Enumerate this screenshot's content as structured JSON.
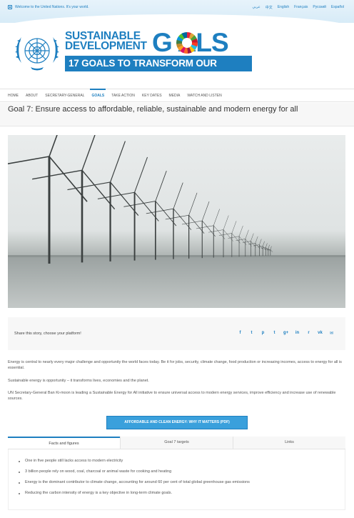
{
  "topbar": {
    "welcome": "Welcome to the United Nations. It's your world.",
    "languages": [
      "عربي",
      "中文",
      "English",
      "Français",
      "Русский",
      "Español"
    ]
  },
  "header": {
    "title_line1": "SUSTAINABLE",
    "title_line2": "DEVELOPMENT",
    "goals_word": "G  ALS",
    "tagline": "17 GOALS TO TRANSFORM OUR WORLD"
  },
  "nav": {
    "items": [
      "HOME",
      "ABOUT",
      "SECRETARY-GENERAL",
      "GOALS",
      "TAKE ACTION",
      "KEY DATES",
      "MEDIA",
      "WATCH AND LISTEN"
    ],
    "active": "GOALS"
  },
  "page": {
    "title": "Goal 7: Ensure access to affordable, reliable, sustainable and modern energy for all"
  },
  "share": {
    "label": "Share this story, choose your platform!",
    "icons": [
      "facebook-icon",
      "twitter-icon",
      "pinterest-icon",
      "tumblr-icon",
      "googleplus-icon",
      "linkedin-icon",
      "reddit-icon",
      "vk-icon",
      "email-icon"
    ],
    "glyphs": [
      "f",
      "t",
      "p",
      "t",
      "g+",
      "in",
      "r",
      "vk",
      "✉"
    ]
  },
  "content": {
    "p1": "Energy is central to nearly every major challenge and opportunity the world faces today. Be it for jobs, security, climate change, food production or increasing incomes, access to energy for all is essential.",
    "p2": "Sustainable energy is opportunity – it transforms lives, economies and the planet.",
    "p3": "UN Secretary-General Ban Ki-moon is leading a Sustainable Energy for All initiative to ensure universal access to modern energy services, improve efficiency and increase use of renewable sources.",
    "pdf_button": "AFFORDABLE AND CLEAN ENERGY: WHY IT MATTERS (PDF)"
  },
  "tabs": {
    "labels": [
      "Facts and figures",
      "Goal 7 targets",
      "Links"
    ],
    "active": "Facts and figures"
  },
  "facts": [
    "One in five people still lacks access to modern electricity",
    "3 billion people rely on wood, coal, charcoal or animal waste for cooking and heating",
    "Energy is the dominant contributor to climate change, accounting for around 60 per cent of total global greenhouse gas emissions",
    "Reducing the carbon intensity of energy is a key objective in long-term climate goals."
  ],
  "colors": {
    "brand_blue": "#1e7fc0",
    "button_blue": "#3aa0dc"
  }
}
